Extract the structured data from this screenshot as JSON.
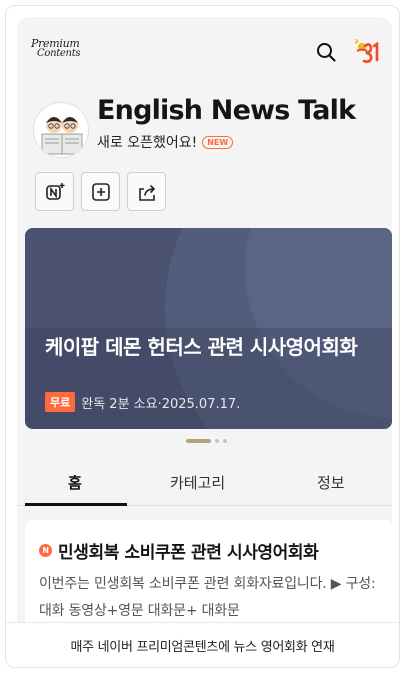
{
  "header": {
    "logo_line1": "Premium",
    "logo_line2": "Contents",
    "icons": [
      "search-icon",
      "brand-badge-icon"
    ]
  },
  "channel": {
    "title": "English News Talk",
    "subtitle": "새로 오픈했어요!",
    "new_badge": "NEW",
    "actions": [
      "naver-subscribe-icon",
      "add-icon",
      "share-icon"
    ]
  },
  "banner": {
    "title": "케이팝 데몬 헌터스 관련 시사영어회화",
    "tag": "무료",
    "meta": "완독 2분 소요·2025.07.17."
  },
  "tabs": [
    {
      "label": "홈",
      "active": true
    },
    {
      "label": "카테고리",
      "active": false
    },
    {
      "label": "정보",
      "active": false
    }
  ],
  "post": {
    "badge": "N",
    "title": "민생회복 소비쿠폰 관련 시사영어회화",
    "body": "이번주는 민생회복 소비쿠폰 관련 회화자료입니다. ▶ 구성: 대화 동영상+영문 대화문+ 대화문"
  },
  "caption": "매주 네이버 프리미엄콘텐츠에 뉴스 영어회화 연재",
  "colors": {
    "accent": "#ff6a3d",
    "banner_bg": "#4c5473",
    "screen_bg": "#f4f4f4"
  }
}
